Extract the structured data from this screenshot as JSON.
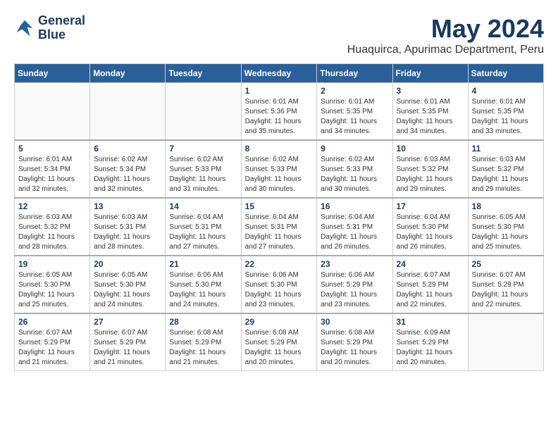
{
  "logo": {
    "line1": "General",
    "line2": "Blue"
  },
  "title": "May 2024",
  "location": "Huaquirca, Apurimac Department, Peru",
  "days_of_week": [
    "Sunday",
    "Monday",
    "Tuesday",
    "Wednesday",
    "Thursday",
    "Friday",
    "Saturday"
  ],
  "weeks": [
    [
      {
        "day": "",
        "content": ""
      },
      {
        "day": "",
        "content": ""
      },
      {
        "day": "",
        "content": ""
      },
      {
        "day": "1",
        "content": "Sunrise: 6:01 AM\nSunset: 5:36 PM\nDaylight: 11 hours and 35 minutes."
      },
      {
        "day": "2",
        "content": "Sunrise: 6:01 AM\nSunset: 5:35 PM\nDaylight: 11 hours and 34 minutes."
      },
      {
        "day": "3",
        "content": "Sunrise: 6:01 AM\nSunset: 5:35 PM\nDaylight: 11 hours and 34 minutes."
      },
      {
        "day": "4",
        "content": "Sunrise: 6:01 AM\nSunset: 5:35 PM\nDaylight: 11 hours and 33 minutes."
      }
    ],
    [
      {
        "day": "5",
        "content": "Sunrise: 6:01 AM\nSunset: 5:34 PM\nDaylight: 11 hours and 32 minutes."
      },
      {
        "day": "6",
        "content": "Sunrise: 6:02 AM\nSunset: 5:34 PM\nDaylight: 11 hours and 32 minutes."
      },
      {
        "day": "7",
        "content": "Sunrise: 6:02 AM\nSunset: 5:33 PM\nDaylight: 11 hours and 31 minutes."
      },
      {
        "day": "8",
        "content": "Sunrise: 6:02 AM\nSunset: 5:33 PM\nDaylight: 11 hours and 30 minutes."
      },
      {
        "day": "9",
        "content": "Sunrise: 6:02 AM\nSunset: 5:33 PM\nDaylight: 11 hours and 30 minutes."
      },
      {
        "day": "10",
        "content": "Sunrise: 6:03 AM\nSunset: 5:32 PM\nDaylight: 11 hours and 29 minutes."
      },
      {
        "day": "11",
        "content": "Sunrise: 6:03 AM\nSunset: 5:32 PM\nDaylight: 11 hours and 29 minutes."
      }
    ],
    [
      {
        "day": "12",
        "content": "Sunrise: 6:03 AM\nSunset: 5:32 PM\nDaylight: 11 hours and 28 minutes."
      },
      {
        "day": "13",
        "content": "Sunrise: 6:03 AM\nSunset: 5:31 PM\nDaylight: 11 hours and 28 minutes."
      },
      {
        "day": "14",
        "content": "Sunrise: 6:04 AM\nSunset: 5:31 PM\nDaylight: 11 hours and 27 minutes."
      },
      {
        "day": "15",
        "content": "Sunrise: 6:04 AM\nSunset: 5:31 PM\nDaylight: 11 hours and 27 minutes."
      },
      {
        "day": "16",
        "content": "Sunrise: 6:04 AM\nSunset: 5:31 PM\nDaylight: 11 hours and 26 minutes."
      },
      {
        "day": "17",
        "content": "Sunrise: 6:04 AM\nSunset: 5:30 PM\nDaylight: 11 hours and 26 minutes."
      },
      {
        "day": "18",
        "content": "Sunrise: 6:05 AM\nSunset: 5:30 PM\nDaylight: 11 hours and 25 minutes."
      }
    ],
    [
      {
        "day": "19",
        "content": "Sunrise: 6:05 AM\nSunset: 5:30 PM\nDaylight: 11 hours and 25 minutes."
      },
      {
        "day": "20",
        "content": "Sunrise: 6:05 AM\nSunset: 5:30 PM\nDaylight: 11 hours and 24 minutes."
      },
      {
        "day": "21",
        "content": "Sunrise: 6:06 AM\nSunset: 5:30 PM\nDaylight: 11 hours and 24 minutes."
      },
      {
        "day": "22",
        "content": "Sunrise: 6:06 AM\nSunset: 5:30 PM\nDaylight: 11 hours and 23 minutes."
      },
      {
        "day": "23",
        "content": "Sunrise: 6:06 AM\nSunset: 5:29 PM\nDaylight: 11 hours and 23 minutes."
      },
      {
        "day": "24",
        "content": "Sunrise: 6:07 AM\nSunset: 5:29 PM\nDaylight: 11 hours and 22 minutes."
      },
      {
        "day": "25",
        "content": "Sunrise: 6:07 AM\nSunset: 5:29 PM\nDaylight: 11 hours and 22 minutes."
      }
    ],
    [
      {
        "day": "26",
        "content": "Sunrise: 6:07 AM\nSunset: 5:29 PM\nDaylight: 11 hours and 21 minutes."
      },
      {
        "day": "27",
        "content": "Sunrise: 6:07 AM\nSunset: 5:29 PM\nDaylight: 11 hours and 21 minutes."
      },
      {
        "day": "28",
        "content": "Sunrise: 6:08 AM\nSunset: 5:29 PM\nDaylight: 11 hours and 21 minutes."
      },
      {
        "day": "29",
        "content": "Sunrise: 6:08 AM\nSunset: 5:29 PM\nDaylight: 11 hours and 20 minutes."
      },
      {
        "day": "30",
        "content": "Sunrise: 6:08 AM\nSunset: 5:29 PM\nDaylight: 11 hours and 20 minutes."
      },
      {
        "day": "31",
        "content": "Sunrise: 6:09 AM\nSunset: 5:29 PM\nDaylight: 11 hours and 20 minutes."
      },
      {
        "day": "",
        "content": ""
      }
    ]
  ]
}
